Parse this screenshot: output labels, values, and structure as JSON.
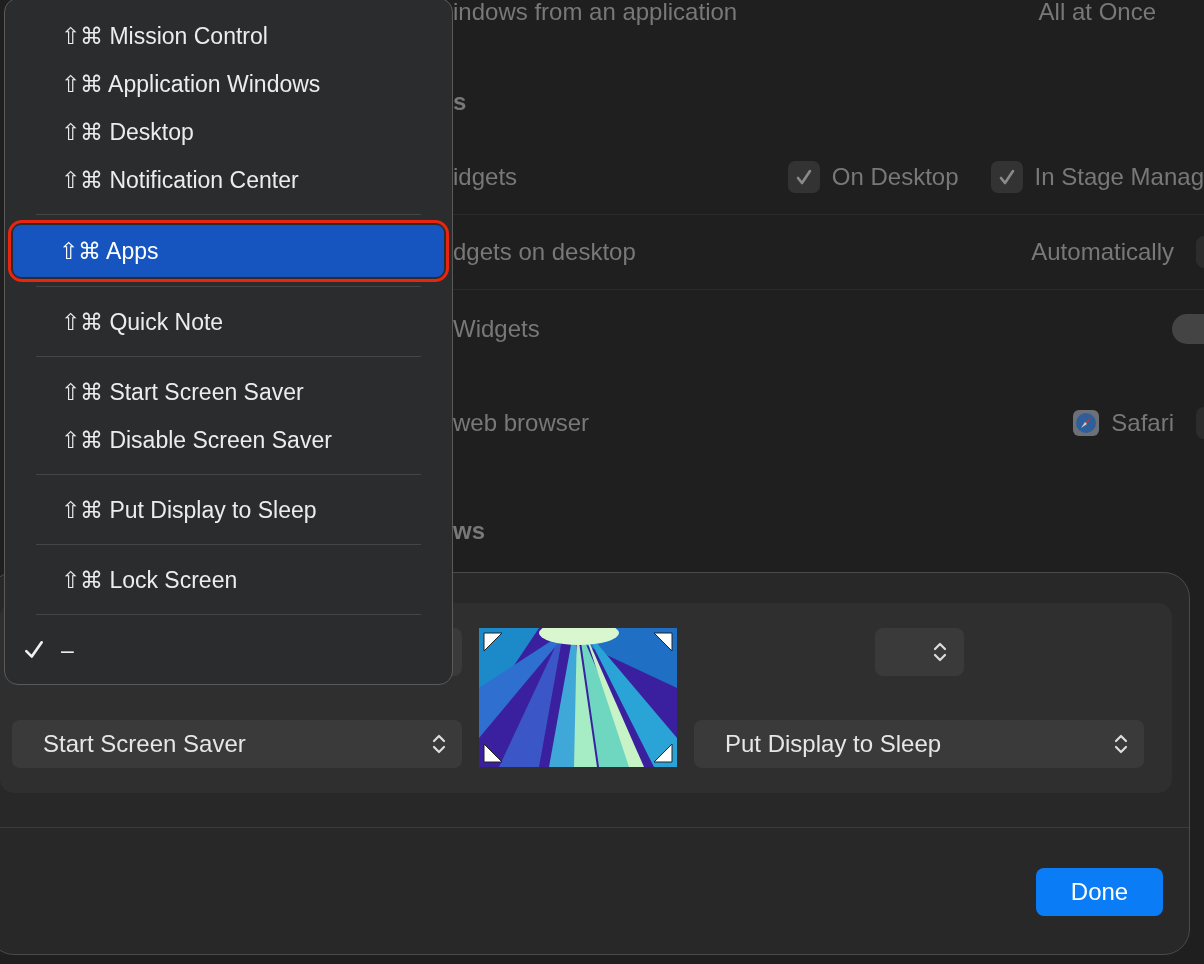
{
  "background": {
    "rows": [
      {
        "kind": "value",
        "label": "indows from an application",
        "value": "All at Once"
      },
      {
        "kind": "heading",
        "label": "s"
      },
      {
        "kind": "checks",
        "label": "idgets",
        "checks": [
          {
            "label": "On Desktop",
            "checked": true
          },
          {
            "label": "In Stage Manag",
            "checked": true
          }
        ]
      },
      {
        "kind": "popup",
        "label": "dgets on desktop",
        "value": "Automatically"
      },
      {
        "kind": "toggle",
        "label": "Widgets",
        "on": false
      },
      {
        "kind": "app",
        "label": "web browser",
        "value": "Safari"
      },
      {
        "kind": "heading",
        "label": "ws"
      }
    ]
  },
  "menu": {
    "groups": [
      [
        {
          "label": "⇧⌘ Mission Control",
          "selected": false,
          "checked": false
        },
        {
          "label": "⇧⌘ Application Windows",
          "selected": false,
          "checked": false
        },
        {
          "label": "⇧⌘ Desktop",
          "selected": false,
          "checked": false
        },
        {
          "label": "⇧⌘ Notification Center",
          "selected": false,
          "checked": false
        }
      ],
      [
        {
          "label": "⇧⌘ Apps",
          "selected": true,
          "checked": false
        }
      ],
      [
        {
          "label": "⇧⌘ Quick Note",
          "selected": false,
          "checked": false
        }
      ],
      [
        {
          "label": "⇧⌘ Start Screen Saver",
          "selected": false,
          "checked": false
        },
        {
          "label": "⇧⌘ Disable Screen Saver",
          "selected": false,
          "checked": false
        }
      ],
      [
        {
          "label": "⇧⌘ Put Display to Sleep",
          "selected": false,
          "checked": false
        }
      ],
      [
        {
          "label": "⇧⌘ Lock Screen",
          "selected": false,
          "checked": false
        }
      ],
      [
        {
          "label": "–",
          "selected": false,
          "checked": true
        }
      ]
    ]
  },
  "hot_corners": {
    "bottom_left": "Start Screen Saver",
    "bottom_right": "Put Display to Sleep"
  },
  "done_button": "Done"
}
